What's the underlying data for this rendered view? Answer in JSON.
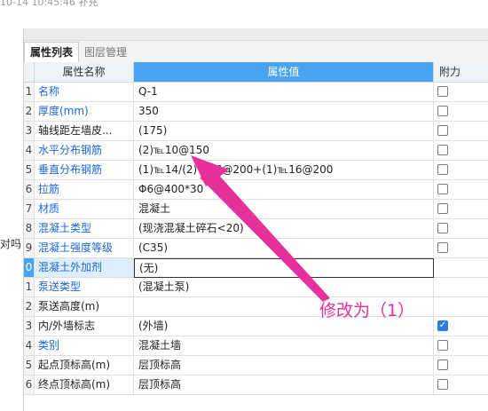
{
  "top_caption": "10-14 10:45:46 补充",
  "left_note": "对吗",
  "tabs": [
    "属性列表",
    "图层管理"
  ],
  "headers": {
    "name": "属性名称",
    "value": "属性值",
    "extra": "附力"
  },
  "rows": [
    {
      "idx": "1",
      "name": "名称",
      "value": "Q-1",
      "name_color": "blue",
      "check": "off"
    },
    {
      "idx": "2",
      "name": "厚度(mm)",
      "value": "350",
      "name_color": "blue",
      "check": "off"
    },
    {
      "idx": "3",
      "name": "轴线距左墙皮...",
      "value": "(175)",
      "name_color": "dark",
      "check": "off"
    },
    {
      "idx": "4",
      "name": "水平分布钢筋",
      "value": "(2)℡10@150",
      "name_color": "blue",
      "check": "off"
    },
    {
      "idx": "5",
      "name": "垂直分布钢筋",
      "value": "(1)℡14/(2)℡16@200+(1)℡16@200",
      "name_color": "blue",
      "check": "off"
    },
    {
      "idx": "6",
      "name": "拉筋",
      "value": "Φ6@400*30",
      "name_color": "blue",
      "check": "off"
    },
    {
      "idx": "7",
      "name": "材质",
      "value": "混凝土",
      "name_color": "blue",
      "check": "off"
    },
    {
      "idx": "8",
      "name": "混凝土类型",
      "value": "(现浇混凝土碎石<20)",
      "name_color": "blue",
      "check": "off"
    },
    {
      "idx": "9",
      "name": "混凝土强度等级",
      "value": "(C35)",
      "name_color": "blue",
      "check": "off"
    },
    {
      "idx": "0",
      "name": "混凝土外加剂",
      "value": "(无)",
      "name_color": "blue",
      "check": "none",
      "selected": true
    },
    {
      "idx": "1",
      "name": "泵送类型",
      "value": "(混凝土泵)",
      "name_color": "blue",
      "check": "none"
    },
    {
      "idx": "2",
      "name": "泵送高度(m)",
      "value": "",
      "name_color": "dark",
      "check": "none"
    },
    {
      "idx": "3",
      "name": "内/外墙标志",
      "value": "(外墙)",
      "name_color": "dark",
      "check": "on"
    },
    {
      "idx": "4",
      "name": "类别",
      "value": "混凝土墙",
      "name_color": "blue",
      "check": "off"
    },
    {
      "idx": "5",
      "name": "起点顶标高(m)",
      "value": "层顶标高",
      "name_color": "dark",
      "check": "off"
    },
    {
      "idx": "6",
      "name": "终点顶标高(m)",
      "value": "层顶标高",
      "name_color": "dark",
      "check": "off"
    }
  ],
  "annotation": {
    "text": "修改为（1）",
    "color": "#e8309a"
  },
  "colors": {
    "header_active": "#4aa3ee",
    "link_blue": "#1a66d6",
    "annotation_pink": "#e8309a"
  }
}
